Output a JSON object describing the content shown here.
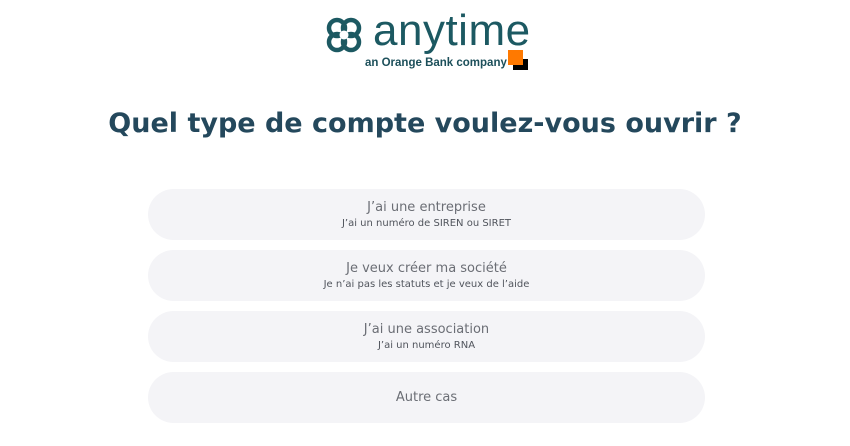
{
  "brand": {
    "name": "anytime",
    "tagline": "an Orange Bank company",
    "colors": {
      "primary": "#1c5962",
      "orange": "#ff7900",
      "black": "#000000"
    }
  },
  "page": {
    "title": "Quel type de compte voulez-vous ouvrir ?"
  },
  "options": [
    {
      "title": "J’ai une entreprise",
      "subtitle": "J’ai un numéro de SIREN ou SIRET"
    },
    {
      "title": "Je veux créer ma société",
      "subtitle": "Je n’ai pas les statuts et je veux de l’aide"
    },
    {
      "title": "J’ai une association",
      "subtitle": "J’ai un numéro RNA"
    },
    {
      "title": "Autre cas",
      "subtitle": ""
    }
  ],
  "icons": {
    "logo": "anytime-logo-icon",
    "badge": "orange-bank-badge-icon"
  }
}
